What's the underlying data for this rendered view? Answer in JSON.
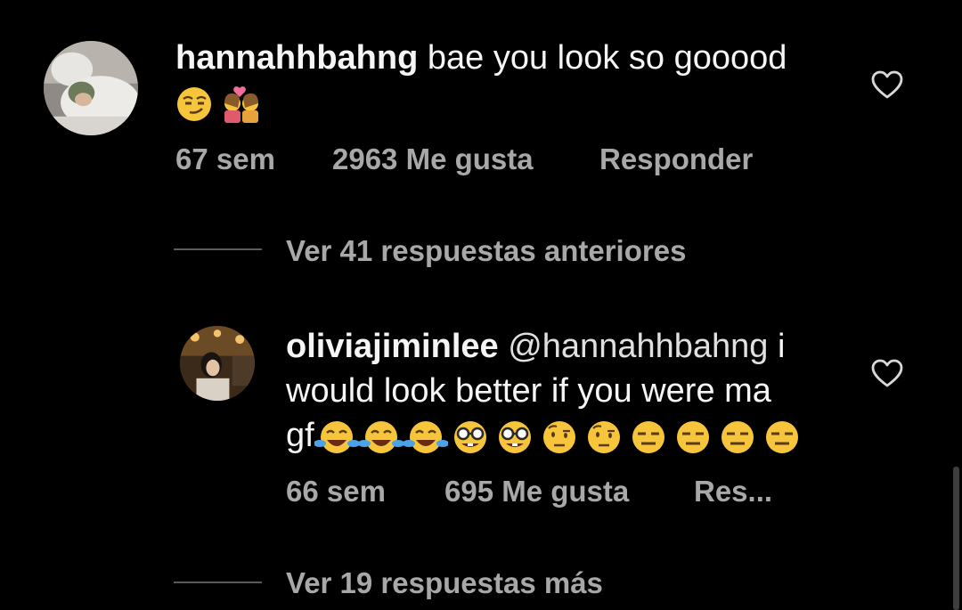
{
  "comment": {
    "username": "hannahhbahng",
    "text": "bae you look so gooood",
    "emojis": [
      "smirking-face",
      "kiss-couple"
    ],
    "time": "67 sem",
    "likes": "2963 Me gusta",
    "reply_label": "Responder"
  },
  "view_previous": "Ver 41 respuestas anteriores",
  "reply": {
    "username": "oliviajiminlee",
    "mention": "@hannahhbahng",
    "text_line1": "i",
    "text_line2": "would look better if you were ma",
    "text_line3": "gf",
    "emojis": [
      "rofl",
      "rofl",
      "rofl",
      "nerd-face",
      "nerd-face",
      "raised-eyebrow-face",
      "raised-eyebrow-face",
      "expressionless-face",
      "expressionless-face",
      "expressionless-face",
      "expressionless-face"
    ],
    "time": "66 sem",
    "likes": "695 Me gusta",
    "reply_label": "Res..."
  },
  "view_more": "Ver 19 respuestas más"
}
